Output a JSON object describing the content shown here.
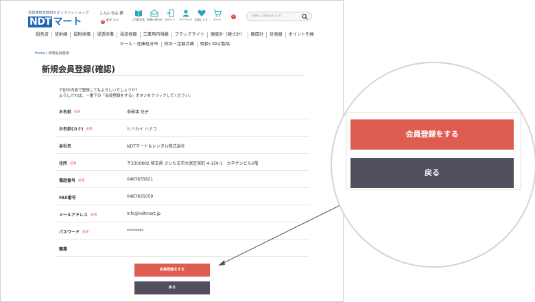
{
  "header": {
    "tagline": "非破壊検査機材のオンラインショップ",
    "logo_ndt": "NDT",
    "logo_mart": "マート",
    "greeting": "こんにちは 様",
    "points_count": "0",
    "points_label": "ポイント",
    "icons": [
      {
        "name": "guide-icon",
        "label": "ご利用方法"
      },
      {
        "name": "mail-icon",
        "label": "お問い合わせ"
      },
      {
        "name": "login-icon",
        "label": "ログイン"
      },
      {
        "name": "mypage-icon",
        "label": "マイページ"
      },
      {
        "name": "favorite-icon",
        "label": "お気に入り"
      },
      {
        "name": "cart-icon",
        "label": "カート"
      }
    ],
    "cart_count": "0",
    "search_placeholder": "お探しの商品を入力"
  },
  "nav": {
    "row1": [
      "超音波",
      "放射線",
      "磁粉探傷",
      "浸透探傷",
      "渦流探傷",
      "工業用内視鏡",
      "ブラックライト",
      "硬度計（硬さ計）",
      "膜厚計",
      "計測器",
      "ポイント引換"
    ],
    "row2": [
      "セール・在庫処分市",
      "校正・定期点検",
      "取扱い中止製品"
    ]
  },
  "breadcrumb": {
    "home": "Home",
    "separator": " / ",
    "current": "新規会員登録"
  },
  "page_title": "新規会員登録(確認)",
  "intro": {
    "line1": "下記の内容で登録してもよろしいでしょうか？",
    "line2": "よろしければ、一番下の「会員登録をする」ボタンをクリックしてください。"
  },
  "required_label": "必須",
  "fields": [
    {
      "label": "お名前",
      "required": true,
      "value": "非破壊 花子"
    },
    {
      "label": "お名前(カナ)",
      "required": true,
      "value": "ヒハカイ ハナコ"
    },
    {
      "label": "会社名",
      "required": false,
      "value": "NDTマート＆レンタル株式会社"
    },
    {
      "label": "住所",
      "required": true,
      "value": "〒3300802 埼玉県 さいたま市大宮区宮町 4-150-1　カネゲンビル2階"
    },
    {
      "label": "電話番号",
      "required": true,
      "value": "0487835821"
    },
    {
      "label": "FAX番号",
      "required": false,
      "value": "0487835059"
    },
    {
      "label": "メールアドレス",
      "required": true,
      "value": "info@ndtmart.jp"
    },
    {
      "label": "パスワード",
      "required": true,
      "value": "********"
    },
    {
      "label": "職業",
      "required": false,
      "value": ""
    }
  ],
  "buttons": {
    "register": "会員登録をする",
    "back": "戻る"
  },
  "colors": {
    "primary_button": "#df5c51",
    "secondary_button": "#514f5e",
    "brand_blue": "#1f67b1",
    "required_red": "#d9463b"
  }
}
